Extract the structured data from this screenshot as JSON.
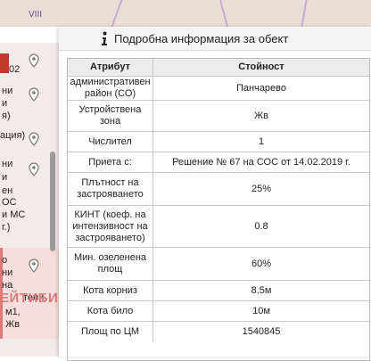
{
  "map": {
    "label": "VIII"
  },
  "left_panel": {
    "lines": [
      "02",
      "ни",
      "и",
      "я)",
      "ация)",
      "ни",
      "и",
      "ен",
      "ОС",
      "и МС",
      "г.)",
      "о",
      "ни",
      "на",
      "тели",
      "м1,",
      "Жв"
    ],
    "watermark": "ЕЙТИБИ"
  },
  "dialog": {
    "title": "Подробна информация за обект",
    "table": {
      "headers": [
        "Атрибут",
        "Стойност"
      ],
      "rows": [
        {
          "attr": "административен район (СО)",
          "value": "Панчарево"
        },
        {
          "attr": "Устройствена зона",
          "value": "Жв"
        },
        {
          "attr": "Числител",
          "value": "1"
        },
        {
          "attr": "Приета с:",
          "value": "Решение № 67 на СОС от 14.02.2019 г."
        },
        {
          "attr": "Плътност на застрояването",
          "value": "25%"
        },
        {
          "attr": "КИНТ (коеф. на интензивност на застрояването)",
          "value": "0.8"
        },
        {
          "attr": "Мин. озеленена площ",
          "value": "60%"
        },
        {
          "attr": "Кота корниз",
          "value": "8.5м"
        },
        {
          "attr": "Кота било",
          "value": "10м"
        },
        {
          "attr": "Площ по ЦМ",
          "value": "1540845"
        }
      ]
    }
  }
}
